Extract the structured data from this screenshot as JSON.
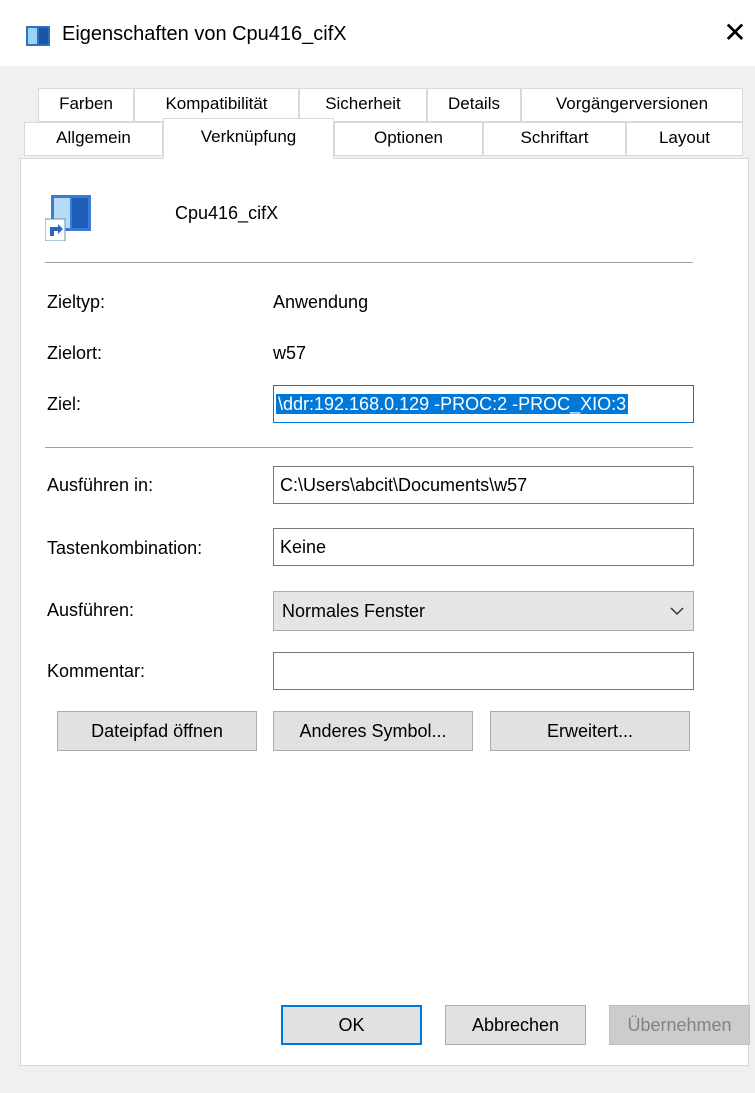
{
  "window": {
    "title": "Eigenschaften von Cpu416_cifX",
    "close_glyph": "✕"
  },
  "tabs": {
    "row1": [
      "Farben",
      "Kompatibilität",
      "Sicherheit",
      "Details",
      "Vorgängerversionen"
    ],
    "row2": [
      "Allgemein",
      "Verknüpfung",
      "Optionen",
      "Schriftart",
      "Layout"
    ],
    "active": "Verknüpfung"
  },
  "shortcut": {
    "name": "Cpu416_cifX",
    "icon": "application-shortcut-icon",
    "fields": {
      "zieltyp_label": "Zieltyp:",
      "zieltyp_value": "Anwendung",
      "zielort_label": "Zielort:",
      "zielort_value": "w57",
      "ziel_label": "Ziel:",
      "ziel_value": "\\ddr:192.168.0.129 -PROC:2 -PROC_XIO:3",
      "ausfuehren_in_label": "Ausführen in:",
      "ausfuehren_in_value": "C:\\Users\\abcit\\Documents\\w57",
      "tastenkombination_label": "Tastenkombination:",
      "tastenkombination_value": "Keine",
      "ausfuehren_label": "Ausführen:",
      "ausfuehren_value": "Normales Fenster",
      "kommentar_label": "Kommentar:",
      "kommentar_value": ""
    },
    "buttons": {
      "open_path": "Dateipfad öffnen",
      "change_icon": "Anderes Symbol...",
      "advanced": "Erweitert..."
    }
  },
  "footer": {
    "ok": "OK",
    "cancel": "Abbrechen",
    "apply": "Übernehmen"
  },
  "colors": {
    "accent": "#0078d7",
    "frame": "#f0f0f0",
    "button": "#e1e1e1"
  }
}
